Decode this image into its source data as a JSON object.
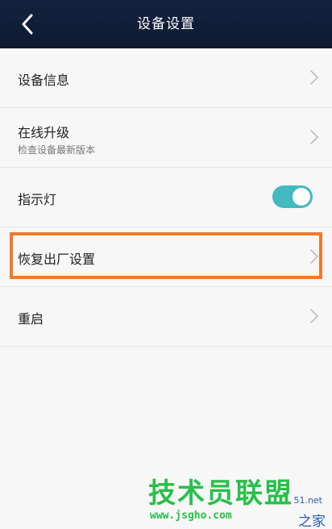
{
  "header": {
    "title": "设备设置",
    "back_icon": "chevron-left-icon"
  },
  "rows": [
    {
      "label": "设备信息",
      "sub": "",
      "control": "chevron"
    },
    {
      "label": "在线升级",
      "sub": "检查设备最新版本",
      "control": "chevron"
    },
    {
      "label": "指示灯",
      "sub": "",
      "control": "toggle",
      "toggle_on": true
    },
    {
      "label": "恢复出厂设置",
      "sub": "",
      "control": "chevron",
      "highlighted": true
    },
    {
      "label": "重启",
      "sub": "",
      "control": "chevron"
    }
  ],
  "colors": {
    "header_bg": "#14223f",
    "toggle_on": "#43b9c0",
    "highlight_border": "#ef7a2b",
    "watermark": "#27c04a"
  },
  "watermark": {
    "main": "技术员联盟",
    "url": "www.jsgho.com",
    "side_small": "51.net",
    "side": "之家"
  }
}
